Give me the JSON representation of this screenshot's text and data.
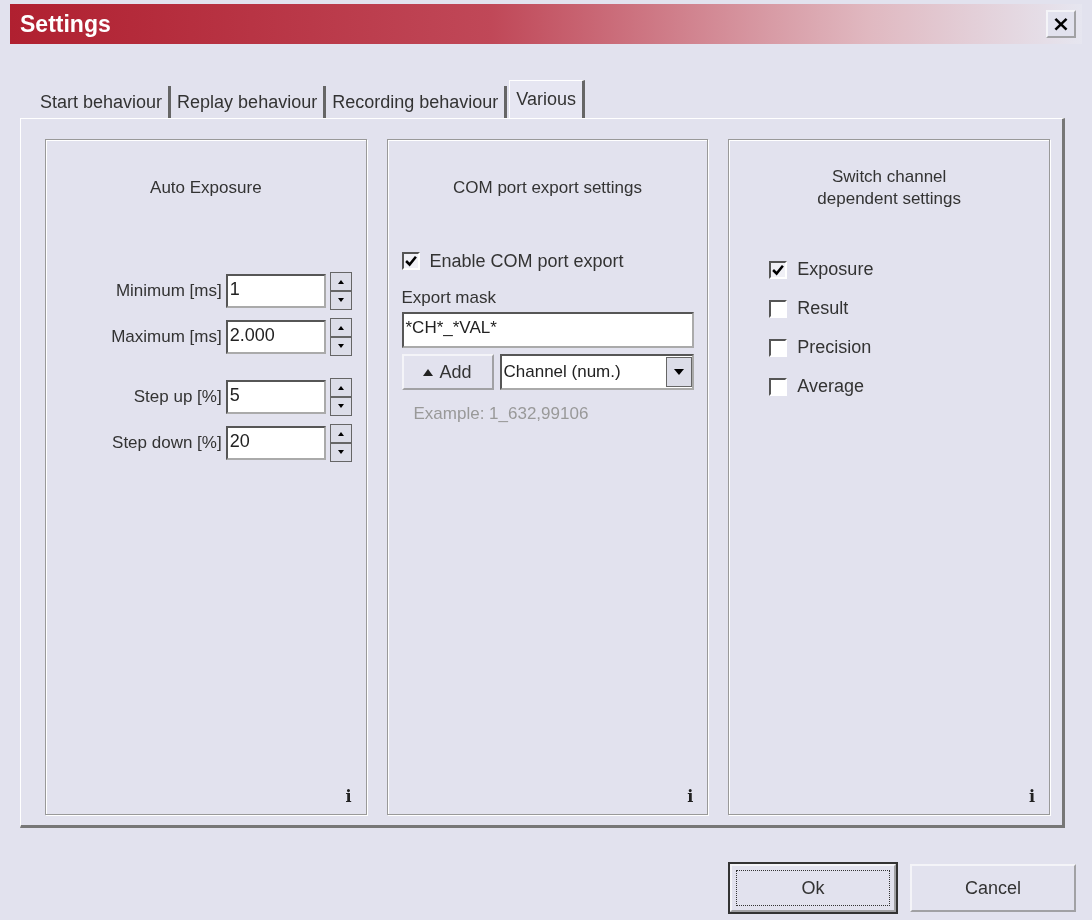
{
  "window": {
    "title": "Settings",
    "close": "×"
  },
  "tabs": [
    {
      "label": "Start behaviour",
      "selected": false
    },
    {
      "label": "Replay behaviour",
      "selected": false
    },
    {
      "label": "Recording behaviour",
      "selected": false
    },
    {
      "label": "Various",
      "selected": true
    }
  ],
  "auto_exposure": {
    "title": "Auto Exposure",
    "info": "i",
    "field_groups": [
      [
        {
          "label": "Minimum  [ms]",
          "value": "1"
        },
        {
          "label": "Maximum  [ms]",
          "value": "2.000"
        }
      ],
      [
        {
          "label": "Step up  [%]",
          "value": "5"
        },
        {
          "label": "Step down  [%]",
          "value": "20"
        }
      ]
    ]
  },
  "com_port": {
    "title": "COM port export settings",
    "info": "i",
    "enable": {
      "label": "Enable COM port export",
      "checked": true
    },
    "mask_label": "Export mask",
    "mask_value": "*CH*_*VAL*",
    "add_button": "Add",
    "dropdown_value": "Channel (num.)",
    "example": "Example:   1_632,99106"
  },
  "switch_channel": {
    "title": "Switch channel dependent settings",
    "info": "i",
    "options": [
      {
        "label": "Exposure",
        "checked": true
      },
      {
        "label": "Result",
        "checked": false
      },
      {
        "label": "Precision",
        "checked": false
      },
      {
        "label": "Average",
        "checked": false
      }
    ]
  },
  "buttons": [
    {
      "label": "Ok",
      "focused": true
    },
    {
      "label": "Cancel",
      "focused": false
    }
  ]
}
